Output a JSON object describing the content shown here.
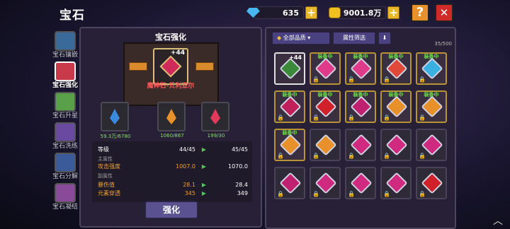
{
  "header": {
    "title": "宝石",
    "diamonds": "635",
    "gold": "9001.8万",
    "help_label": "?",
    "close_label": "✕"
  },
  "sidebar": {
    "items": [
      {
        "label": "宝石镶嵌",
        "color": "#3a6a9a"
      },
      {
        "label": "宝石强化",
        "color": "#c83a4a"
      },
      {
        "label": "宝石升星",
        "color": "#5aa04a"
      },
      {
        "label": "宝石洗练",
        "color": "#6a4aa0"
      },
      {
        "label": "宝石分解",
        "color": "#3a5a9a"
      },
      {
        "label": "宝石凝结",
        "color": "#8a4a9a"
      }
    ],
    "active_index": 1
  },
  "left": {
    "title": "宝石强化",
    "main_level": "+44",
    "gem_name": "魔神石-贝利亚尔",
    "materials": [
      {
        "name": "blue-crystal",
        "count": "59.3万/6780",
        "color": "#3a8ae0"
      },
      {
        "name": "orange-crystal",
        "count": "1060/867",
        "color": "#e8902a"
      },
      {
        "name": "red-crystal",
        "count": "199/30",
        "color": "#e03a5a"
      }
    ],
    "stats": {
      "level_label": "等级",
      "level_from": "44/45",
      "level_to": "45/45",
      "main_attr_title": "主属性",
      "main_label": "攻击强度",
      "main_from": "1007.0",
      "main_to": "1070.0",
      "sub_attr_title": "副属性",
      "sub1_label": "暴伤值",
      "sub1_from": "28.1",
      "sub1_to": "28.4",
      "sub2_label": "元素穿透",
      "sub2_from": "345",
      "sub2_to": "349"
    },
    "upgrade_label": "强化"
  },
  "right": {
    "quality_filter": "全部品质",
    "attr_filter": "属性筛选",
    "sort_icon": "down-arrow-icon",
    "count": "35/500",
    "equipped_label": "装备中",
    "cells": [
      {
        "eq": false,
        "lv": "+44",
        "color": "#3a8a3a",
        "lock": false,
        "sel": true
      },
      {
        "eq": true,
        "color": "#e03a8a",
        "lock": true
      },
      {
        "eq": true,
        "color": "#e03a8a",
        "lock": true
      },
      {
        "eq": true,
        "color": "#e0483a",
        "lock": true
      },
      {
        "eq": true,
        "color": "#3ab0e0",
        "lock": true
      },
      {
        "eq": true,
        "color": "#c0205a",
        "lock": true
      },
      {
        "eq": true,
        "color": "#d0202a",
        "lock": true
      },
      {
        "eq": true,
        "color": "#c02070",
        "lock": true
      },
      {
        "eq": true,
        "color": "#e8902a",
        "lock": true
      },
      {
        "eq": true,
        "color": "#e8902a",
        "lock": true
      },
      {
        "eq": true,
        "color": "#e8902a",
        "lock": true
      },
      {
        "eq": false,
        "color": "#e8902a",
        "lock": true
      },
      {
        "eq": false,
        "color": "#d02a80",
        "lock": true
      },
      {
        "eq": false,
        "color": "#d02a80",
        "lock": true
      },
      {
        "eq": false,
        "color": "#d02a80",
        "lock": true
      },
      {
        "eq": false,
        "color": "#c02070",
        "lock": true
      },
      {
        "eq": false,
        "color": "#d02a80",
        "lock": true
      },
      {
        "eq": false,
        "color": "#d02a80",
        "lock": true
      },
      {
        "eq": false,
        "color": "#d02a80",
        "lock": true
      },
      {
        "eq": false,
        "color": "#d0202a",
        "lock": true
      }
    ]
  }
}
